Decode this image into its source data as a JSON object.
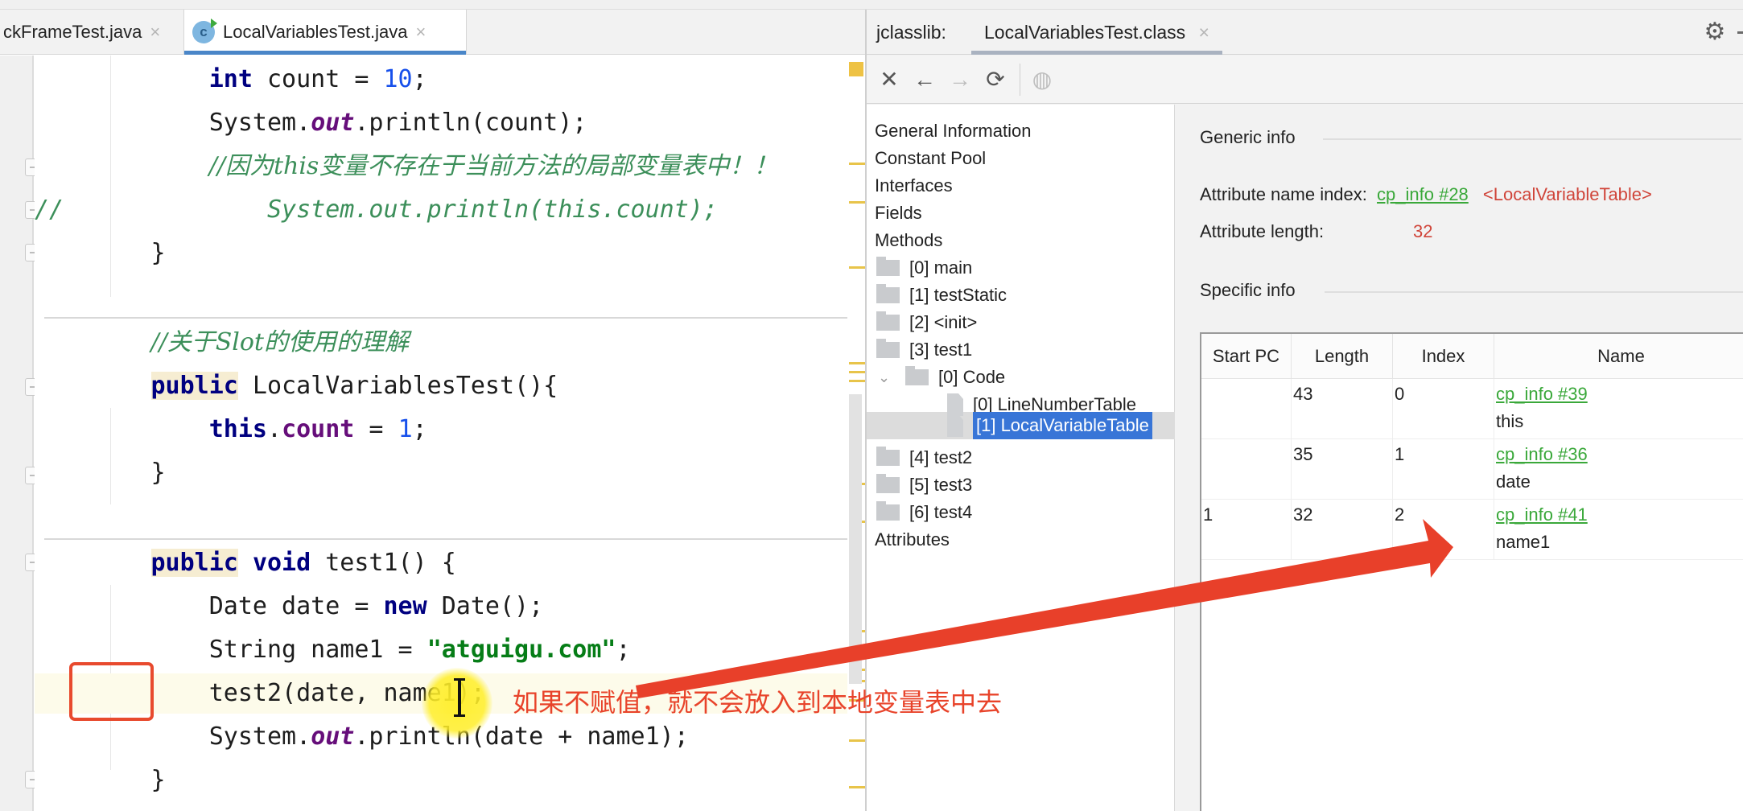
{
  "editor": {
    "tabs": [
      {
        "label": "ckFrameTest.java",
        "active": false
      },
      {
        "label": "LocalVariablesTest.java",
        "active": true
      }
    ],
    "tab_close_glyph": "×",
    "class_icon_letter": "c",
    "lines": {
      "l1": {
        "kw": "int",
        "rest": " count = ",
        "num": "10",
        "end": ";"
      },
      "l2": {
        "a": "System.",
        "field": "out",
        "b": ".println(count);"
      },
      "l3": {
        "comment": "//因为this变量不存在于当前方法的局部变量表中！！"
      },
      "l4": {
        "prefix": "//",
        "comment": "System.out.println(this.count);"
      },
      "l5": {
        "text": "}"
      },
      "l6": {
        "comment": "//关于Slot的使用的理解"
      },
      "l7": {
        "kw": "public",
        "rest": " LocalVariablesTest(){"
      },
      "l8": {
        "kw": "this",
        "dot": ".",
        "field": "count",
        "rest": " = ",
        "num": "1",
        "end": ";"
      },
      "l9": {
        "text": "}"
      },
      "l10": {
        "kw1": "public",
        "kw2": "void",
        "rest": " test1() {"
      },
      "l11": {
        "a": "Date date = ",
        "kw": "new",
        "b": " Date();"
      },
      "l12": {
        "a": "String name1 = ",
        "str": "\"atguigu.com\"",
        "b": ";"
      },
      "l13": {
        "text": "test2(date, name1);"
      },
      "l14": {
        "a": "System.",
        "field": "out",
        "b": ".println(date + name1);"
      },
      "l15": {
        "text": "}"
      }
    },
    "annotation_text": "如果不赋值，就不会放入到本地变量表中去",
    "annotation_color": "#e8432a"
  },
  "jclasslib": {
    "title": "jclasslib:",
    "tab_label": "LocalVariablesTest.class",
    "tab_close_glyph": "×",
    "settings_icon": "⚙",
    "toolbar": {
      "close": "✕",
      "back": "←",
      "forward": "→",
      "refresh": "⟳",
      "browser": "◍"
    },
    "tree": {
      "top_items": [
        "General Information",
        "Constant Pool",
        "Interfaces",
        "Fields",
        "Methods"
      ],
      "methods": [
        "[0] main",
        "[1] testStatic",
        "[2] <init>",
        "[3] test1"
      ],
      "code_node": "[0] Code",
      "chevron": "⌄",
      "code_children": [
        "[0] LineNumberTable",
        "[1] LocalVariableTable"
      ],
      "selected": "[1] LocalVariableTable",
      "more_methods": [
        "[4] test2",
        "[5] test3",
        "[6] test4"
      ],
      "attributes": "Attributes"
    },
    "generic_info": {
      "title": "Generic info",
      "name_index_label": "Attribute name index:",
      "name_index_link": "cp_info #28",
      "name_index_value": "<LocalVariableTable>",
      "length_label": "Attribute length:",
      "length_value": "32"
    },
    "specific_info": {
      "title": "Specific info",
      "columns": [
        "Start PC",
        "Length",
        "Index",
        "Name"
      ],
      "rows": [
        {
          "start_pc": "",
          "length": "43",
          "index": "0",
          "name_link": "cp_info #39",
          "name": "this"
        },
        {
          "start_pc": "",
          "length": "35",
          "index": "1",
          "name_link": "cp_info #36",
          "name": "date"
        },
        {
          "start_pc": "1",
          "length": "32",
          "index": "2",
          "name_link": "cp_info #41",
          "name": "name1"
        }
      ]
    }
  }
}
